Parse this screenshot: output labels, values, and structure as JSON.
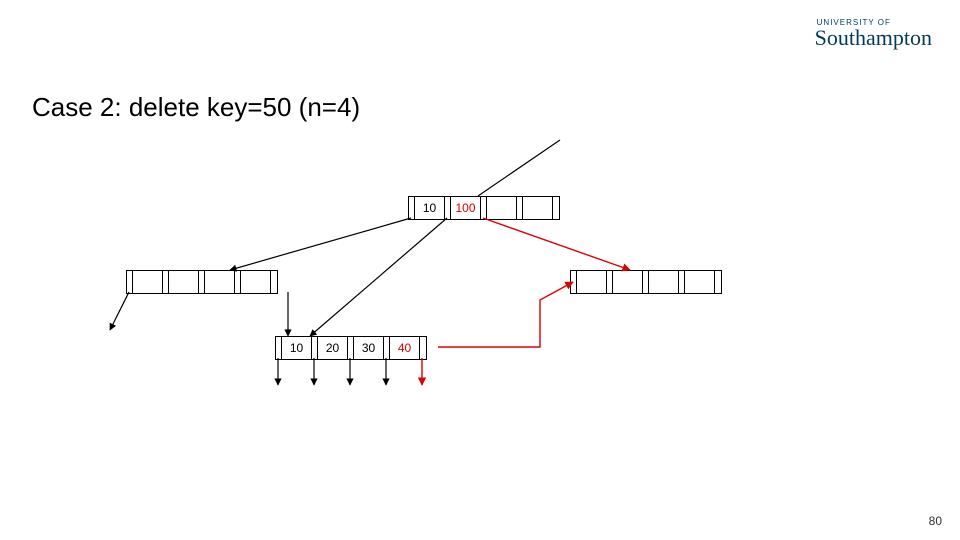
{
  "logo": {
    "small": "UNIVERSITY OF",
    "big": "Southampton"
  },
  "title": "Case 2: delete key=50 (n=4)",
  "page_number": "80",
  "root": {
    "keys": [
      "10",
      "100",
      "",
      ""
    ],
    "highlight": [
      false,
      true,
      false,
      false
    ]
  },
  "left_child": {
    "keys": [
      "",
      "",
      "",
      ""
    ]
  },
  "right_child": {
    "keys": [
      "",
      "",
      "",
      ""
    ]
  },
  "leaf": {
    "keys": [
      "10",
      "20",
      "30",
      "40"
    ],
    "highlight": [
      false,
      false,
      false,
      true
    ]
  }
}
